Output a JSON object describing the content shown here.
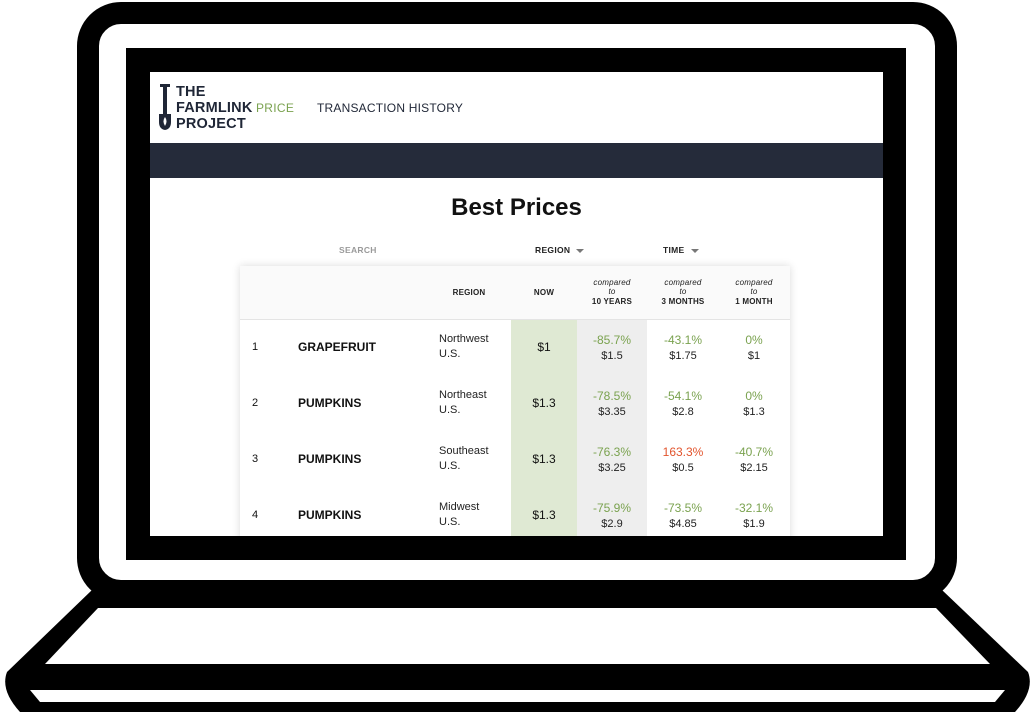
{
  "logo": {
    "line1": "THE",
    "line2": "FARMLINK",
    "line3": "PROJECT"
  },
  "nav": {
    "price": "PRICE",
    "history": "TRANSACTION HISTORY"
  },
  "page": {
    "title": "Best Prices"
  },
  "filters": {
    "search": "SEARCH",
    "region": "REGION",
    "time": "TIME"
  },
  "table": {
    "headers": {
      "region": "REGION",
      "now": "NOW",
      "comp_word": "compared",
      "to_word": "to",
      "ten_years": "10 YEARS",
      "three_months": "3 MONTHS",
      "one_month": "1 MONTH"
    },
    "rows": [
      {
        "rank": "1",
        "item": "GRAPEFRUIT",
        "region1": "Northwest",
        "region2": "U.S.",
        "now": "$1",
        "y10_pct": "-85.7%",
        "y10_price": "$1.5",
        "m3_pct": "-43.1%",
        "m3_price": "$1.75",
        "m1_pct": "0%",
        "m1_price": "$1"
      },
      {
        "rank": "2",
        "item": "PUMPKINS",
        "region1": "Northeast",
        "region2": "U.S.",
        "now": "$1.3",
        "y10_pct": "-78.5%",
        "y10_price": "$3.35",
        "m3_pct": "-54.1%",
        "m3_price": "$2.8",
        "m1_pct": "0%",
        "m1_price": "$1.3"
      },
      {
        "rank": "3",
        "item": "PUMPKINS",
        "region1": "Southeast",
        "region2": "U.S.",
        "now": "$1.3",
        "y10_pct": "-76.3%",
        "y10_price": "$3.25",
        "m3_pct": "163.3%",
        "m3_price": "$0.5",
        "m1_pct": "-40.7%",
        "m1_price": "$2.15"
      },
      {
        "rank": "4",
        "item": "PUMPKINS",
        "region1": "Midwest",
        "region2": "U.S.",
        "now": "$1.3",
        "y10_pct": "-75.9%",
        "y10_price": "$2.9",
        "m3_pct": "-73.5%",
        "m3_price": "$4.85",
        "m1_pct": "-32.1%",
        "m1_price": "$1.9"
      }
    ]
  },
  "colors": {
    "positive_change": "#7aa24f",
    "negative_change": "#e2542d",
    "header_band": "#252b3a",
    "now_column": "#dfe9d3"
  }
}
